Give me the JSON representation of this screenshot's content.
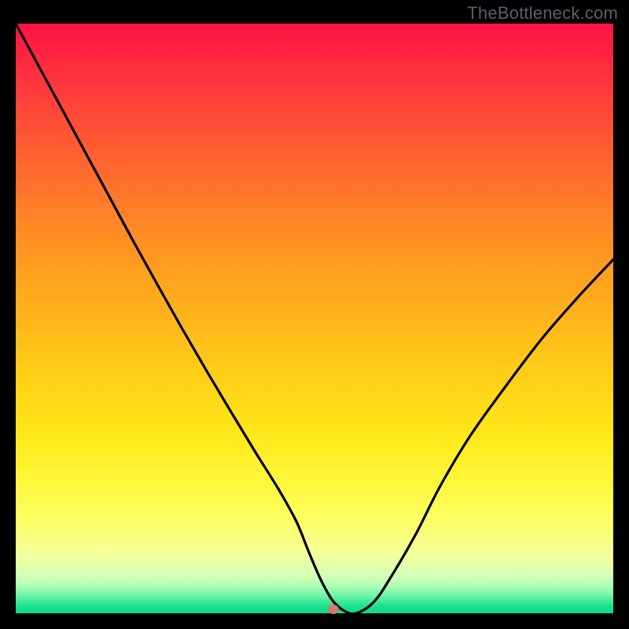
{
  "watermark": "TheBottleneck.com",
  "chart_data": {
    "type": "line",
    "title": "",
    "xlabel": "",
    "ylabel": "",
    "xlim": [
      0,
      100
    ],
    "ylim": [
      0,
      100
    ],
    "grid": false,
    "legend": false,
    "background_gradient": {
      "direction": "vertical",
      "stops": [
        {
          "pos": 0.0,
          "color": "#ff1244"
        },
        {
          "pos": 0.5,
          "color": "#ffc018"
        },
        {
          "pos": 0.8,
          "color": "#fcfe55"
        },
        {
          "pos": 1.0,
          "color": "#0cdd8a"
        }
      ]
    },
    "series": [
      {
        "name": "bottleneck-curve",
        "color": "#000000",
        "x": [
          0,
          4,
          8,
          12,
          16,
          20,
          24,
          28,
          32,
          36,
          40,
          44,
          47,
          49,
          51,
          53,
          55,
          57,
          60,
          63,
          67,
          71,
          76,
          82,
          88,
          94,
          100
        ],
        "y": [
          100,
          92.5,
          85,
          77.5,
          70,
          62.5,
          55.2,
          48,
          41,
          34.2,
          27.5,
          21,
          15.5,
          10.5,
          5.8,
          2.2,
          0.4,
          0.0,
          2.0,
          6.5,
          13.5,
          21.5,
          30.0,
          38.5,
          46.5,
          53.5,
          60.0
        ]
      }
    ],
    "marker": {
      "name": "optimal-point",
      "x": 53.2,
      "y": 0.7,
      "color": "#d4766d"
    }
  }
}
